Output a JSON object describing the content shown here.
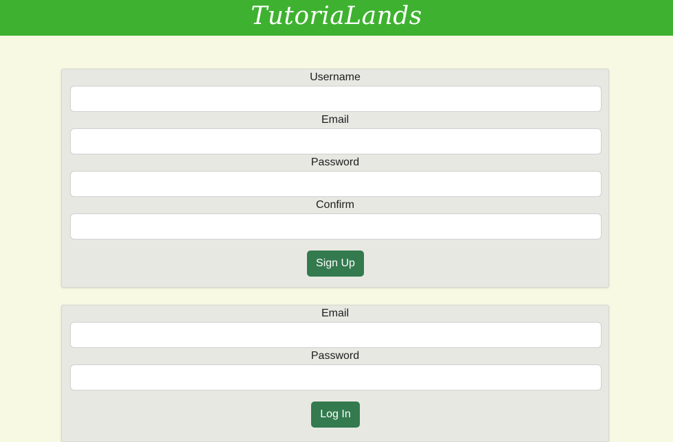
{
  "header": {
    "brand": "TutoriaLands",
    "accent_color": "#3eb230"
  },
  "signup": {
    "username_label": "Username",
    "username_value": "",
    "email_label": "Email",
    "email_value": "",
    "password_label": "Password",
    "password_value": "",
    "confirm_label": "Confirm",
    "confirm_value": "",
    "submit_label": "Sign Up"
  },
  "login": {
    "email_label": "Email",
    "email_value": "",
    "password_label": "Password",
    "password_value": "",
    "submit_label": "Log In"
  },
  "colors": {
    "page_background": "#f7f9e3",
    "panel_background": "#e8e8e3",
    "button_background": "#337a4e"
  }
}
